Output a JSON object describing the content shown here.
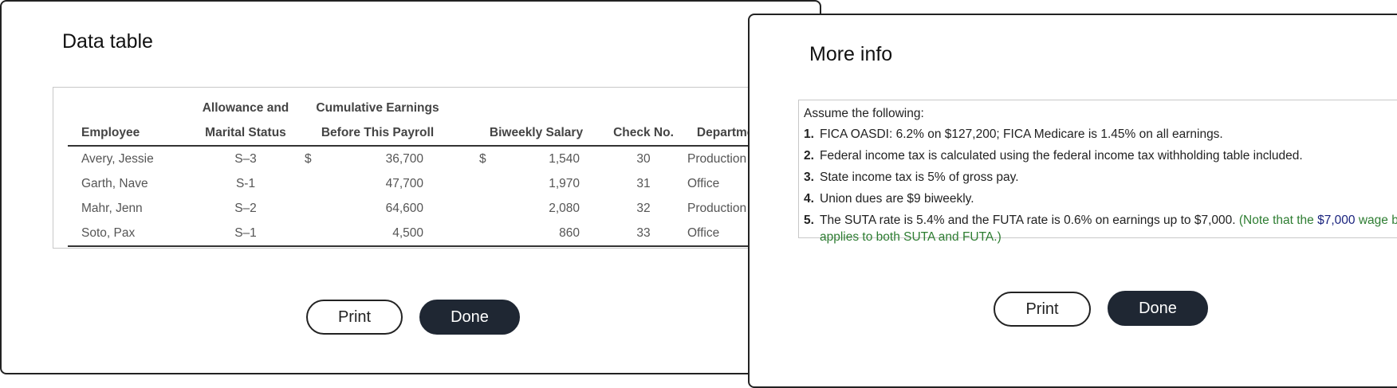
{
  "data_table": {
    "title": "Data table",
    "headers": {
      "employee": "Employee",
      "status_line1": "Allowance and",
      "status_line2": "Marital Status",
      "cumulative_line1": "Cumulative Earnings",
      "cumulative_line2": "Before This Payroll",
      "biweekly": "Biweekly Salary",
      "check": "Check No.",
      "department": "Department"
    },
    "currency_symbol": "$",
    "rows": [
      {
        "employee": "Avery, Jessie",
        "status": "S–3",
        "cumulative": "36,700",
        "biweekly": "1,540",
        "check": "30",
        "department": "Production"
      },
      {
        "employee": "Garth, Nave",
        "status": "S-1",
        "cumulative": "47,700",
        "biweekly": "1,970",
        "check": "31",
        "department": "Office"
      },
      {
        "employee": "Mahr, Jenn",
        "status": "S–2",
        "cumulative": "64,600",
        "biweekly": "2,080",
        "check": "32",
        "department": "Production"
      },
      {
        "employee": "Soto, Pax",
        "status": "S–1",
        "cumulative": "4,500",
        "biweekly": "860",
        "check": "33",
        "department": "Office"
      }
    ],
    "print_label": "Print",
    "done_label": "Done"
  },
  "more_info": {
    "title": "More info",
    "intro": "Assume the following:",
    "items": [
      {
        "num": "1.",
        "text": "FICA OASDI: 6.2% on $127,200; FICA Medicare is 1.45% on all earnings."
      },
      {
        "num": "2.",
        "text": "Federal income tax is calculated using the federal income tax withholding table included."
      },
      {
        "num": "3.",
        "text": "State income tax is 5% of gross pay."
      },
      {
        "num": "4.",
        "text": "Union dues are $9 biweekly."
      },
      {
        "num": "5.",
        "text": "The SUTA rate is 5.4% and the FUTA rate is 0.6% on earnings up to $7,000.",
        "note_a": "(Note that the ",
        "note_amount": "$7,000",
        "note_b": " wage base applies to both SUTA and FUTA.)"
      }
    ],
    "print_label": "Print",
    "done_label": "Done"
  },
  "colors": {
    "note_green": "#2e7d32",
    "note_blue": "#1a237e",
    "done_button": "#1f2733"
  }
}
